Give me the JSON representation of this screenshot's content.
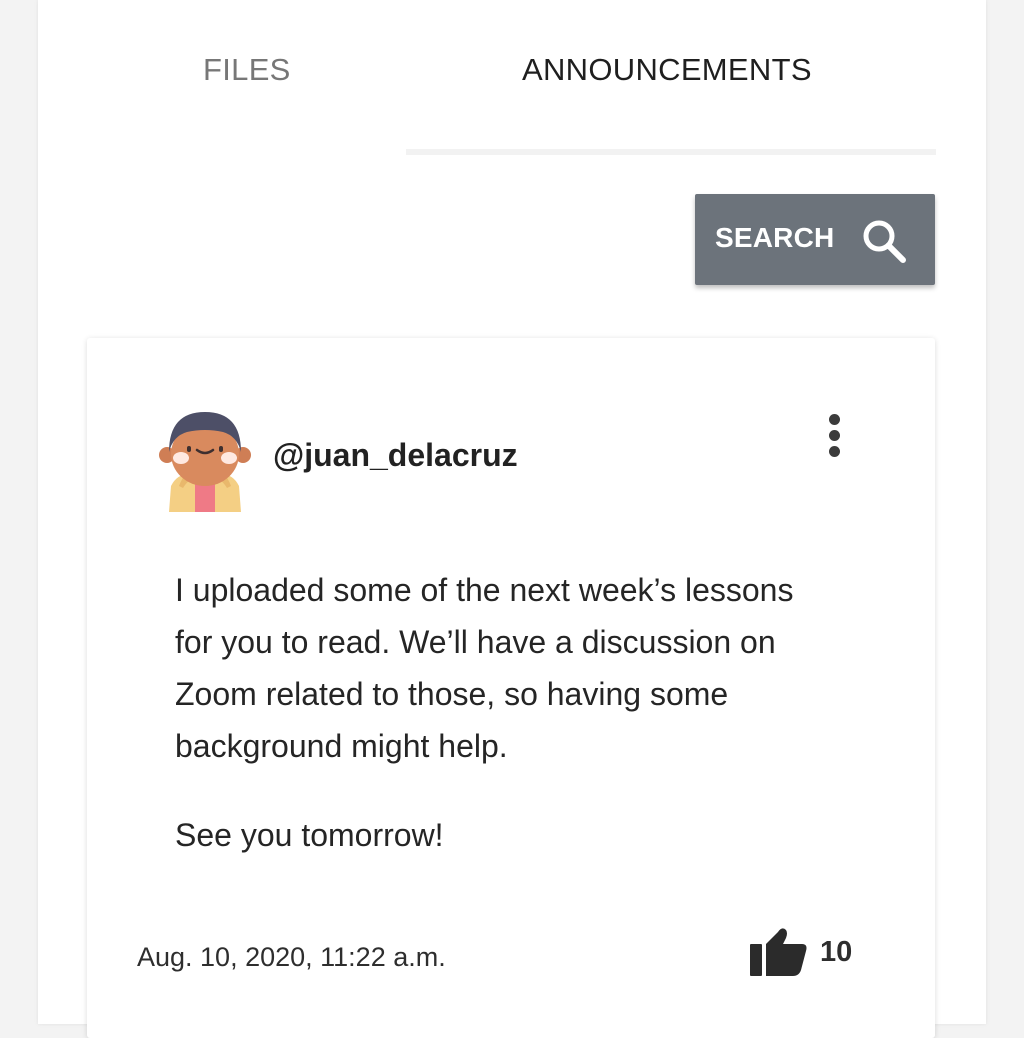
{
  "tabs": [
    {
      "label": "FILES",
      "active": false
    },
    {
      "label": "ANNOUNCEMENTS",
      "active": true
    }
  ],
  "search": {
    "label": "SEARCH",
    "icon": "search-icon",
    "color": "#6c737b"
  },
  "post": {
    "username": "@juan_delacruz",
    "avatar": "avatar-illustration",
    "menu_icon": "more-vertical-icon",
    "body": "I uploaded some of the next week’s lessons for you to read. We’ll have a discussion on Zoom related to those, so having some background might help.",
    "closing": "See you tomorrow!",
    "timestamp": "Aug. 10, 2020, 11:22 a.m.",
    "likes_icon": "thumbs-up-icon",
    "likes": "10"
  }
}
